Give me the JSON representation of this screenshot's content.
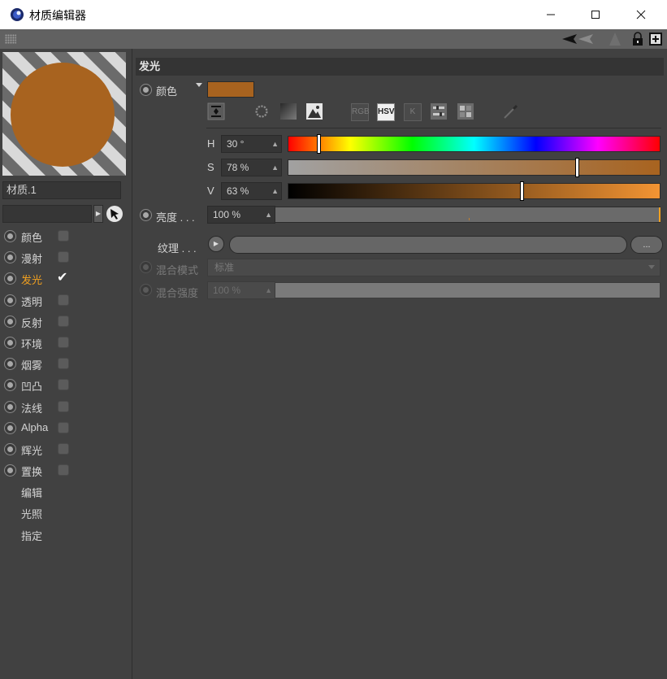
{
  "window": {
    "title": "材质编辑器",
    "minimize_symbol": "—",
    "maximize_symbol": "☐",
    "close_symbol": "✕"
  },
  "toolbar": {
    "icons": [
      "grip-icon",
      "back-arrow-icon",
      "forward-arrow-icon",
      "lock-icon",
      "new-panel-icon"
    ]
  },
  "material": {
    "name": "材质.1",
    "preview_color": "#a8631f"
  },
  "channels": [
    {
      "label": "颜色",
      "checked": false,
      "active": false
    },
    {
      "label": "漫射",
      "checked": false,
      "active": false
    },
    {
      "label": "发光",
      "checked": true,
      "active": true
    },
    {
      "label": "透明",
      "checked": false,
      "active": false
    },
    {
      "label": "反射",
      "checked": false,
      "active": false
    },
    {
      "label": "环境",
      "checked": false,
      "active": false
    },
    {
      "label": "烟雾",
      "checked": false,
      "active": false
    },
    {
      "label": "凹凸",
      "checked": false,
      "active": false
    },
    {
      "label": "法线",
      "checked": false,
      "active": false
    },
    {
      "label": "Alpha",
      "checked": false,
      "active": false
    },
    {
      "label": "辉光",
      "checked": false,
      "active": false
    },
    {
      "label": "置换",
      "checked": false,
      "active": false
    }
  ],
  "sub_items": [
    "编辑",
    "光照",
    "指定"
  ],
  "luminance": {
    "section_title": "发光",
    "color_label": "颜色",
    "color_value": "#a8631f",
    "color_modes": {
      "rgb_label": "RGB",
      "hsv_label": "HSV",
      "k_label": "K",
      "active": "HSV"
    },
    "h": {
      "letter": "H",
      "value": "30 °",
      "fraction": 0.083
    },
    "s": {
      "letter": "S",
      "value": "78 %",
      "fraction": 0.78
    },
    "v": {
      "letter": "V",
      "value": "63 %",
      "fraction": 0.63
    },
    "brightness_label": "亮度 . . .",
    "brightness_value": "100 %",
    "texture_label": "纹理 . . .",
    "texture_more": "...",
    "blend_mode_label": "混合模式",
    "blend_mode_value": "标准",
    "blend_strength_label": "混合强度",
    "blend_strength_value": "100 %"
  },
  "colors": {
    "accent": "#f0a020",
    "panel": "#414141",
    "title_bar": "#ffffff"
  }
}
